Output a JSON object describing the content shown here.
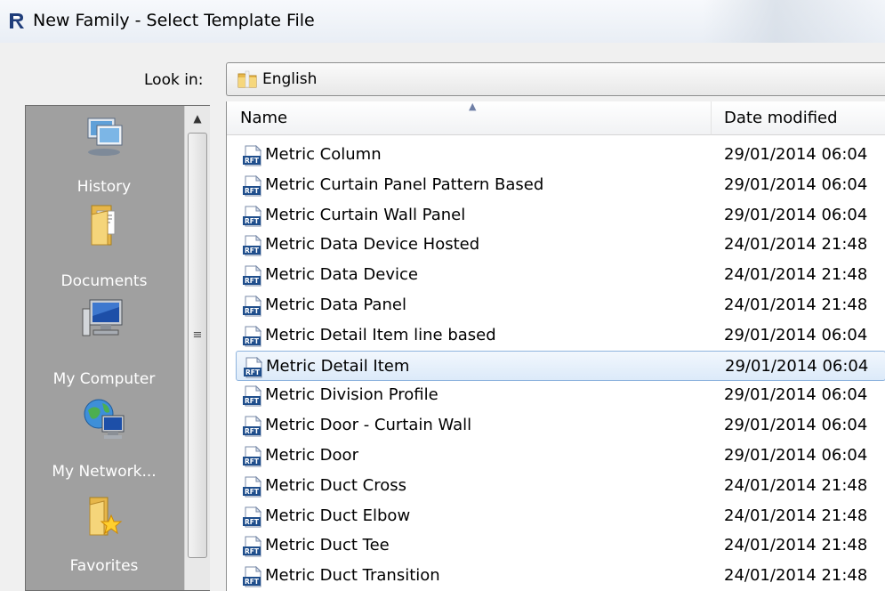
{
  "window": {
    "title": "New Family - Select Template File",
    "app_icon": "revit-logo-icon"
  },
  "look_in": {
    "label": "Look in:",
    "value": "English",
    "icon": "folder-icon"
  },
  "places": [
    {
      "label": "History",
      "icon": "history-icon"
    },
    {
      "label": "Documents",
      "icon": "documents-folder-icon"
    },
    {
      "label": "My Computer",
      "icon": "computer-icon"
    },
    {
      "label": "My Network...",
      "icon": "network-globe-icon"
    },
    {
      "label": "Favorites",
      "icon": "favorites-folder-icon"
    }
  ],
  "file_list": {
    "columns": {
      "name": "Name",
      "date": "Date modified"
    },
    "sorted_by": "name",
    "file_icon_label": "RFT",
    "selected_index": 7,
    "rows": [
      {
        "name": "Metric Column",
        "date": "29/01/2014 06:04"
      },
      {
        "name": "Metric Curtain Panel Pattern Based",
        "date": "29/01/2014 06:04"
      },
      {
        "name": "Metric Curtain Wall Panel",
        "date": "29/01/2014 06:04"
      },
      {
        "name": "Metric Data Device Hosted",
        "date": "24/01/2014 21:48"
      },
      {
        "name": "Metric Data Device",
        "date": "24/01/2014 21:48"
      },
      {
        "name": "Metric Data Panel",
        "date": "24/01/2014 21:48"
      },
      {
        "name": "Metric Detail Item line based",
        "date": "29/01/2014 06:04"
      },
      {
        "name": "Metric Detail Item",
        "date": "29/01/2014 06:04"
      },
      {
        "name": "Metric Division Profile",
        "date": "29/01/2014 06:04"
      },
      {
        "name": "Metric Door - Curtain Wall",
        "date": "29/01/2014 06:04"
      },
      {
        "name": "Metric Door",
        "date": "29/01/2014 06:04"
      },
      {
        "name": "Metric Duct Cross",
        "date": "24/01/2014 21:48"
      },
      {
        "name": "Metric Duct Elbow",
        "date": "24/01/2014 21:48"
      },
      {
        "name": "Metric Duct Tee",
        "date": "24/01/2014 21:48"
      },
      {
        "name": "Metric Duct Transition",
        "date": "24/01/2014 21:48"
      }
    ]
  },
  "colors": {
    "selection_fill": "#dceaf9",
    "selection_border": "#8fb4de",
    "places_bg": "#a0a0a0"
  }
}
